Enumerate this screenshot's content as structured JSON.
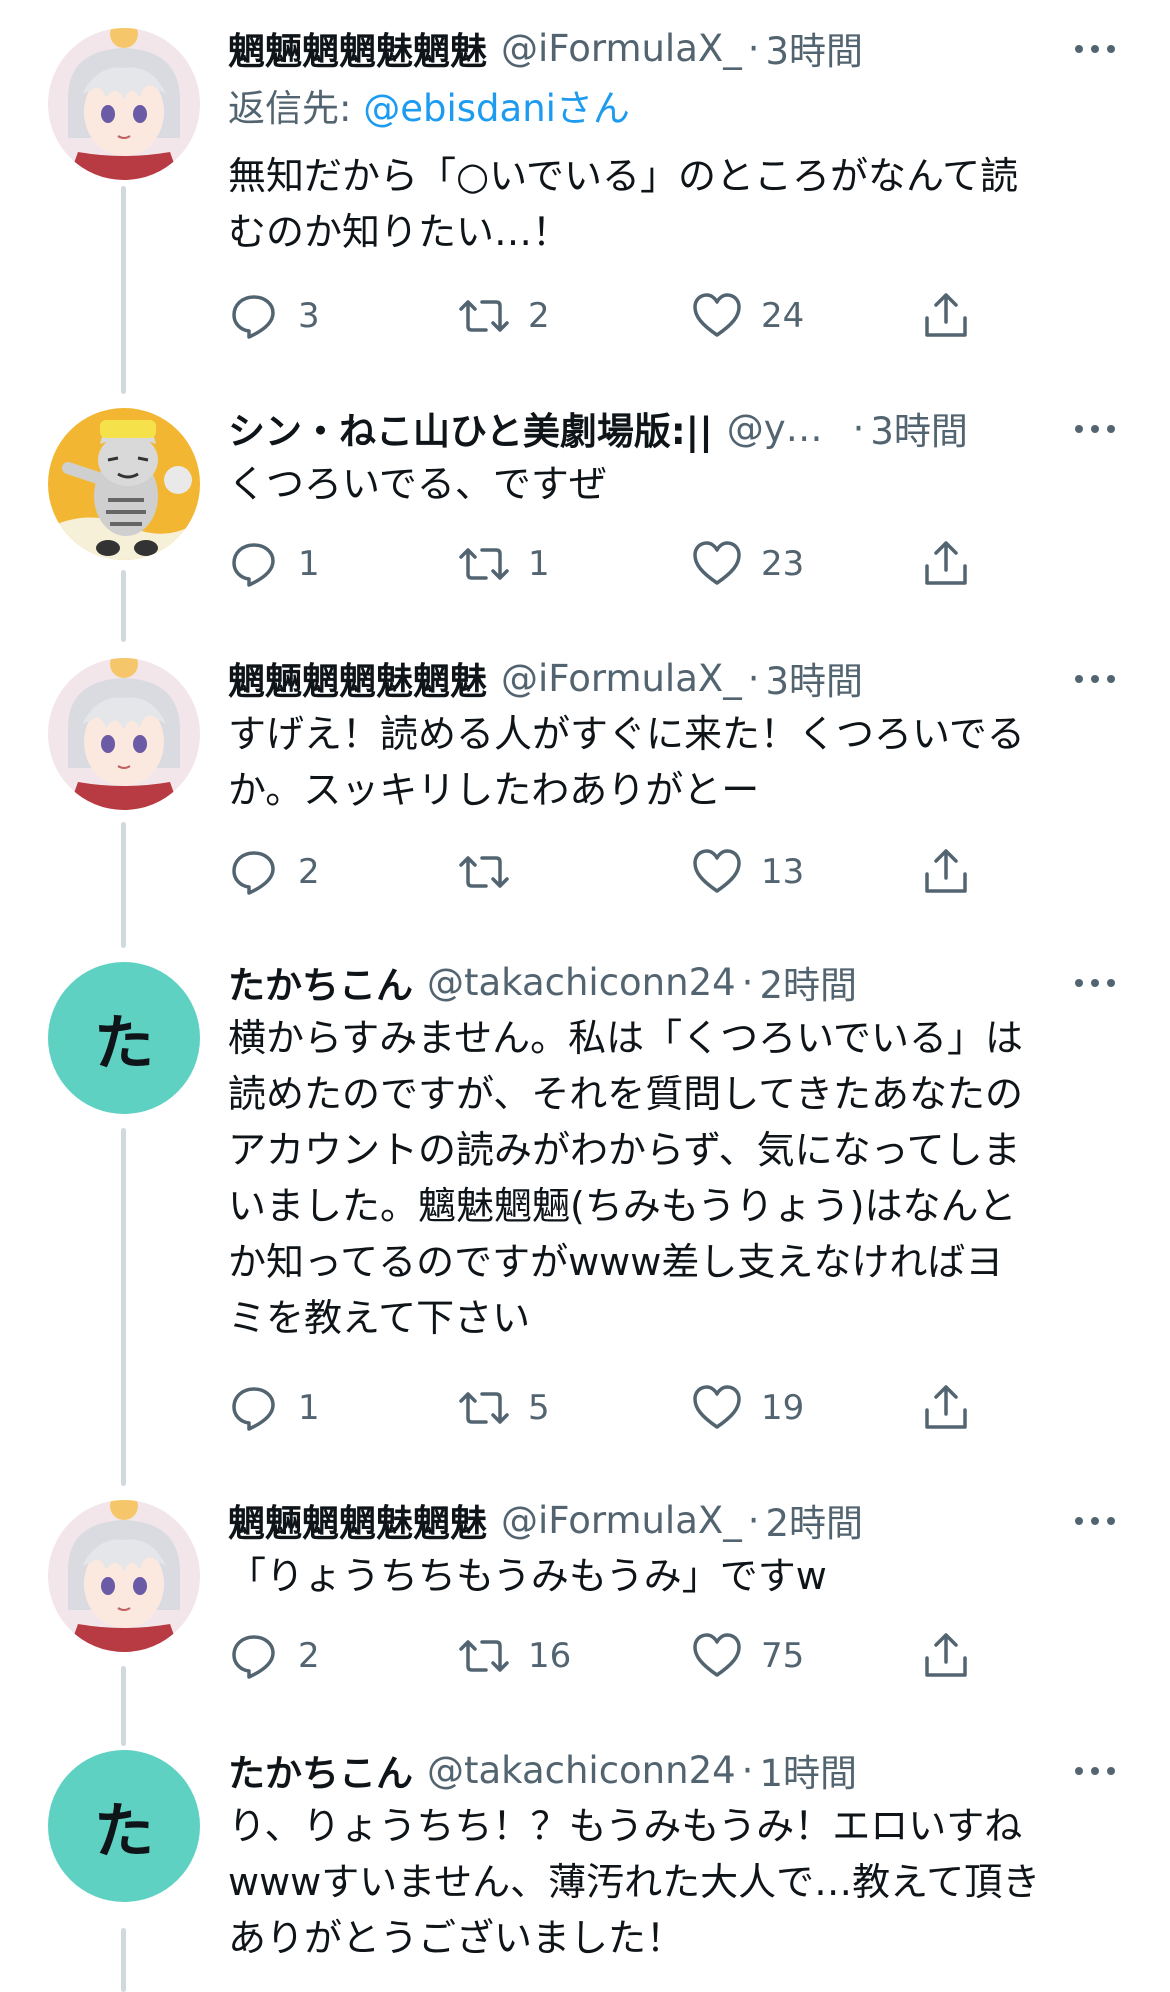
{
  "tweets": [
    {
      "name": "魍魎魍魍魅魍魅",
      "handle": "@iFormulaX_",
      "dot": "·",
      "time": "3時間",
      "reply_label": "返信先: ",
      "reply_mention": "@ebisdaniさん",
      "lines": [
        "無知だから「○いでいる」のところがなんて読",
        "むのか知りたい…！"
      ],
      "reply_count": "3",
      "retweet_count": "2",
      "like_count": "24",
      "avatar": "anime-girl-avatar"
    },
    {
      "name": "シン・ねこ山ひと美劇場版:||",
      "handle": "@y…",
      "dot": "·",
      "time": "3時間",
      "lines": [
        "くつろいでる、ですぜ"
      ],
      "reply_count": "1",
      "retweet_count": "1",
      "like_count": "23",
      "avatar": "cat-illustration-avatar"
    },
    {
      "name": "魍魎魍魍魅魍魅",
      "handle": "@iFormulaX_",
      "dot": "·",
      "time": "3時間",
      "lines": [
        "すげえ！読める人がすぐに来た！くつろいでる",
        "か。スッキリしたわありがとー"
      ],
      "reply_count": "2",
      "retweet_count": "",
      "like_count": "13",
      "avatar": "anime-girl-avatar"
    },
    {
      "name": "たかちこん",
      "handle": "@takachiconn24",
      "dot": "·",
      "time": "2時間",
      "lines": [
        "横からすみません。私は「くつろいでいる」は",
        "読めたのですが、それを質問してきたあなたの",
        "アカウントの読みがわからず、気になってしま",
        "いました。魑魅魍魎(ちみもうりょう)はなんと",
        "か知ってるのですがwww差し支えなければヨ",
        "ミを教えて下さい"
      ],
      "reply_count": "1",
      "retweet_count": "5",
      "like_count": "19",
      "avatar_letter": "た"
    },
    {
      "name": "魍魎魍魍魅魍魅",
      "handle": "@iFormulaX_",
      "dot": "·",
      "time": "2時間",
      "lines": [
        "「りょうちちもうみもうみ」ですw"
      ],
      "reply_count": "2",
      "retweet_count": "16",
      "like_count": "75",
      "avatar": "anime-girl-avatar"
    },
    {
      "name": "たかちこん",
      "handle": "@takachiconn24",
      "dot": "·",
      "time": "1時間",
      "lines": [
        "り、りょうちち！？もうみもうみ！エロいすね",
        "wwwすいません、薄汚れた大人で…教えて頂き",
        "ありがとうございました！"
      ],
      "avatar_letter": "た"
    }
  ],
  "icons": [
    "reply-icon",
    "retweet-icon",
    "like-icon",
    "share-icon",
    "more-icon"
  ],
  "colors": {
    "secondary_text": "#536471",
    "link": "#1d9bf0",
    "thread_line": "#cfd9de",
    "avatar_teal": "#5ed1c3"
  }
}
